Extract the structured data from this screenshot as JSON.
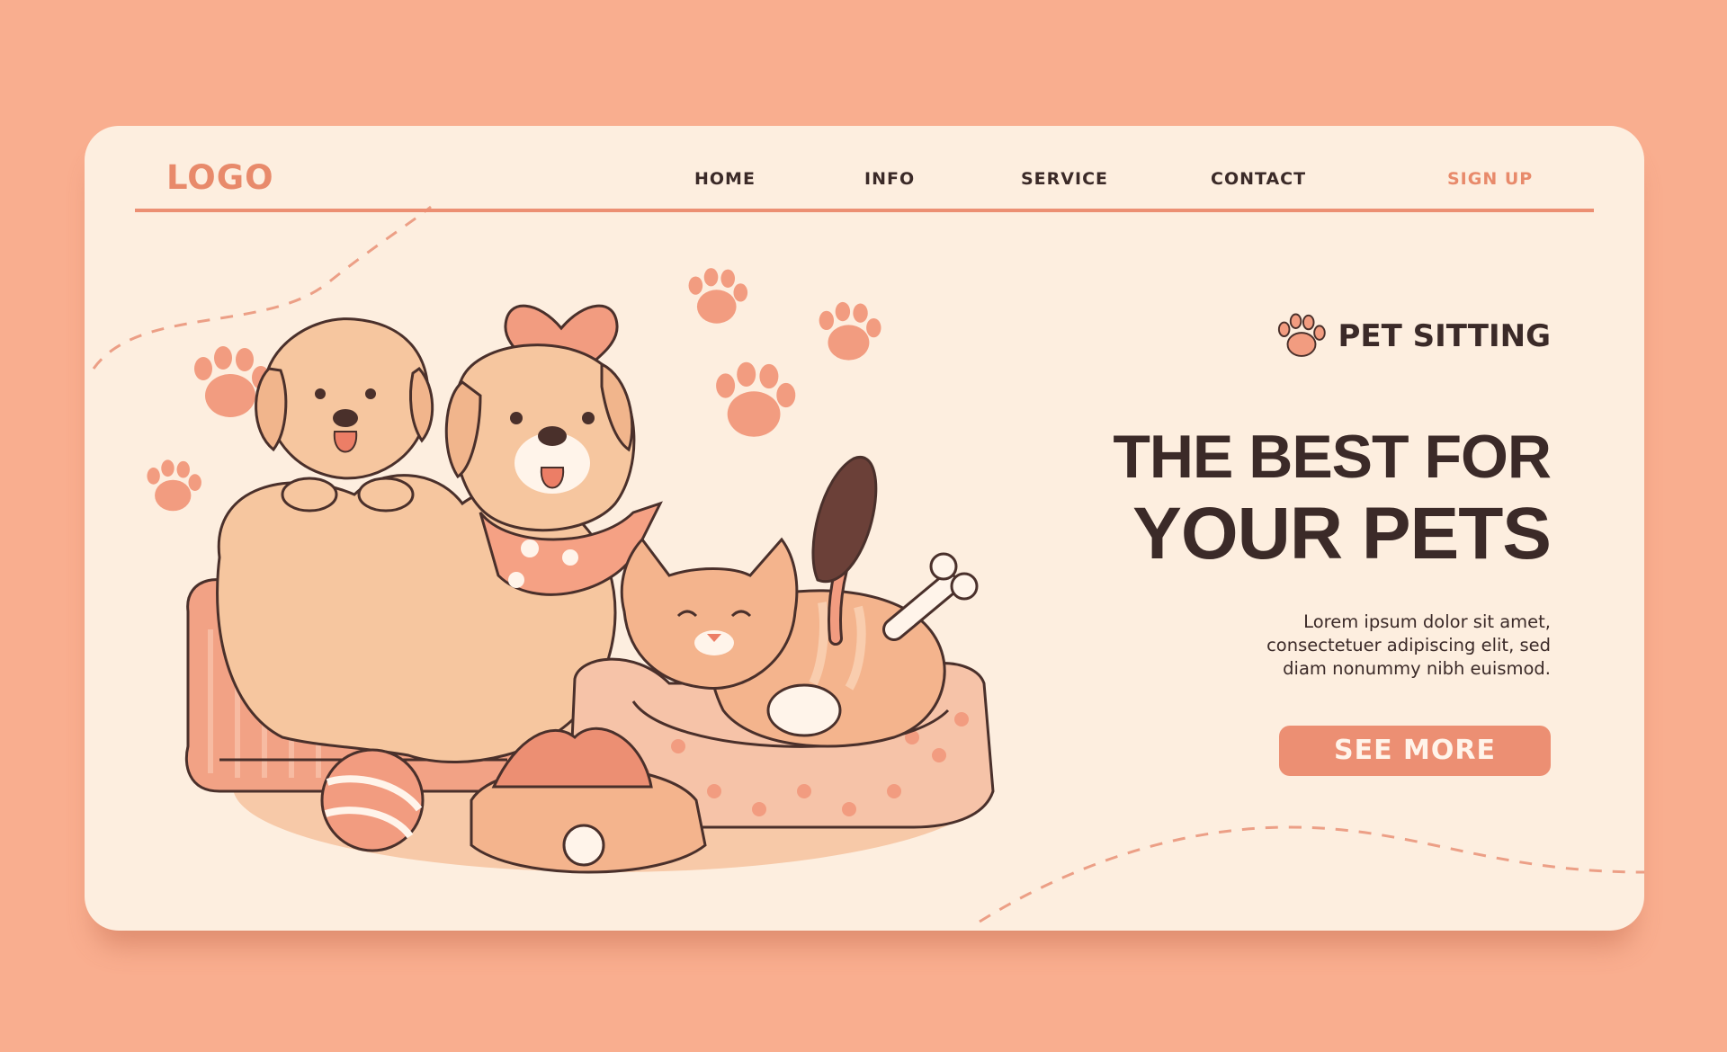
{
  "header": {
    "logo": "LOGO",
    "nav": [
      "HOME",
      "INFO",
      "SERVICE",
      "CONTACT"
    ],
    "signup": "SIGN UP"
  },
  "hero": {
    "eyebrow": "PET SITTING",
    "headline_line1": "THE BEST FOR",
    "headline_line2": "YOUR PETS",
    "description_lines": [
      "Lorem ipsum dolor sit amet,",
      "consectetuer adipiscing elit, sed",
      "diam nonummy nibh euismod."
    ],
    "cta": "SEE MORE"
  },
  "colors": {
    "page_bg": "#F9AE8F",
    "card_bg": "#FDEEDF",
    "accent": "#EC8F73",
    "text_dark": "#3B2A28"
  },
  "icons": [
    "paw-icon",
    "heart-icon",
    "brush-icon",
    "bone-icon",
    "ball-icon",
    "food-bowl-icon"
  ]
}
